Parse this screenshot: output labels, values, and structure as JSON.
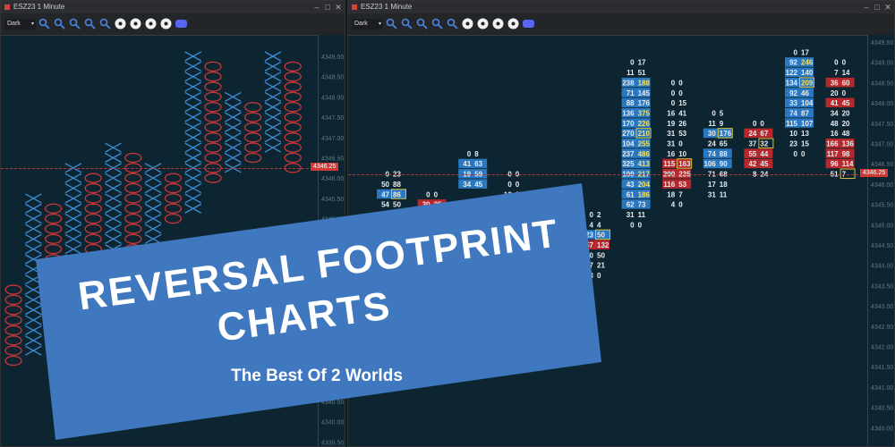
{
  "left_window": {
    "title": "ESZ23 1 Minute",
    "theme_select": "Dark",
    "toolbar_icons": [
      "layout-icon",
      "zoom-in-icon",
      "zoom-out-icon",
      "search-icon",
      "pencil-tool-icon",
      "cursor-icon",
      "line-icon",
      "info-icon",
      "refresh-icon",
      "discord-icon"
    ],
    "price_tag": "4346.25",
    "axis_labels": [
      "4349.00",
      "4348.50",
      "4348.00",
      "4347.50",
      "4347.00",
      "4346.50",
      "4346.00",
      "4345.50",
      "4345.00",
      "4344.50",
      "4344.00",
      "4343.50",
      "4343.00",
      "4342.50",
      "4342.00",
      "4341.50",
      "4341.00",
      "4340.50",
      "4340.00",
      "4339.50"
    ]
  },
  "right_window": {
    "title": "ESZ23 1 Minute",
    "theme_select": "Dark",
    "toolbar_icons": [
      "layout-icon",
      "zoom-in-icon",
      "zoom-out-icon",
      "search-icon",
      "pencil-tool-icon",
      "cursor-icon",
      "line-icon",
      "info-icon",
      "refresh-icon",
      "discord-icon"
    ],
    "price_tag": "4346.25",
    "axis_labels": [
      "4349.50",
      "4349.00",
      "4348.50",
      "4348.00",
      "4347.50",
      "4347.00",
      "4346.50",
      "4346.00",
      "4345.50",
      "4345.00",
      "4344.50",
      "4344.00",
      "4343.50",
      "4343.00",
      "4342.50",
      "4342.00",
      "4341.50",
      "4341.00",
      "4340.50",
      "4340.00",
      "4339.50"
    ]
  },
  "banner": {
    "title_line1": "REVERSAL FOOTPRINT",
    "title_line2": "CHARTS",
    "subtitle": "The Best Of 2 Worlds",
    "color": "#3f78bf"
  },
  "chart_data": [
    {
      "type": "point_and_figure",
      "price_step": 0.25,
      "ylim": [
        4339.5,
        4349.25
      ],
      "columns": [
        {
          "kind": "O",
          "high": 4343.25,
          "low": 4341.5
        },
        {
          "kind": "X",
          "high": 4345.5,
          "low": 4341.75
        },
        {
          "kind": "O",
          "high": 4345.25,
          "low": 4342.5
        },
        {
          "kind": "X",
          "high": 4346.25,
          "low": 4342.75
        },
        {
          "kind": "O",
          "high": 4346.0,
          "low": 4343.25
        },
        {
          "kind": "X",
          "high": 4346.75,
          "low": 4343.5
        },
        {
          "kind": "O",
          "high": 4346.5,
          "low": 4344.0
        },
        {
          "kind": "X",
          "high": 4346.25,
          "low": 4344.25
        },
        {
          "kind": "O",
          "high": 4346.0,
          "low": 4345.0
        },
        {
          "kind": "X",
          "high": 4349.0,
          "low": 4345.25
        },
        {
          "kind": "O",
          "high": 4348.75,
          "low": 4346.0
        },
        {
          "kind": "X",
          "high": 4348.0,
          "low": 4346.25
        },
        {
          "kind": "O",
          "high": 4347.75,
          "low": 4346.5
        },
        {
          "kind": "X",
          "high": 4349.0,
          "low": 4346.75
        },
        {
          "kind": "O",
          "high": 4348.75,
          "low": 4346.25
        }
      ],
      "colors": {
        "X": "#3c8dd6",
        "O": "#c8363a"
      }
    },
    {
      "type": "footprint",
      "ylim": [
        4339.5,
        4349.5
      ],
      "columns": [
        {
          "top": 4346.25,
          "cells": [
            [
              "0",
              "23"
            ],
            [
              "50",
              "88"
            ],
            [
              "47",
              "86"
            ],
            [
              "54",
              "50"
            ]
          ],
          "colors": [
            "n",
            "n",
            "b",
            "n"
          ],
          "box": 2
        },
        {
          "top": 4345.75,
          "cells": [
            [
              "0",
              "0"
            ],
            [
              "30",
              "25"
            ],
            [
              "33",
              "17"
            ]
          ],
          "colors": [
            "n",
            "r",
            "n"
          ]
        },
        {
          "top": 4346.75,
          "cells": [
            [
              "0",
              "8"
            ],
            [
              "41",
              "63"
            ],
            [
              "19",
              "59"
            ],
            [
              "34",
              "45"
            ]
          ],
          "colors": [
            "n",
            "b",
            "b",
            "b"
          ]
        },
        {
          "top": 4346.25,
          "cells": [
            [
              "0",
              "0"
            ],
            [
              "0",
              "0"
            ],
            [
              "13",
              "17"
            ]
          ],
          "colors": [
            "n",
            "n",
            "n"
          ]
        },
        {
          "top": 4345.75,
          "cells": [
            [
              "0",
              "50"
            ]
          ],
          "colors": [
            "n"
          ]
        },
        {
          "top": 4345.25,
          "cells": [
            [
              "0",
              "2"
            ],
            [
              "4",
              "4"
            ],
            [
              "23",
              "50"
            ],
            [
              "57",
              "132"
            ],
            [
              "50",
              "50"
            ],
            [
              "27",
              "21"
            ],
            [
              "3",
              "0"
            ]
          ],
          "colors": [
            "n",
            "n",
            "b",
            "r",
            "n",
            "n",
            "n"
          ],
          "box": 2
        },
        {
          "top": 4349.0,
          "cells": [
            [
              "0",
              "17"
            ],
            [
              "11",
              "51"
            ],
            [
              "238",
              "188"
            ],
            [
              "71",
              "145"
            ],
            [
              "88",
              "176"
            ],
            [
              "136",
              "375"
            ],
            [
              "170",
              "226"
            ],
            [
              "270",
              "210"
            ],
            [
              "104",
              "255"
            ],
            [
              "237",
              "486"
            ],
            [
              "325",
              "413"
            ],
            [
              "109",
              "217"
            ],
            [
              "43",
              "204"
            ],
            [
              "61",
              "186"
            ],
            [
              "62",
              "73"
            ],
            [
              "31",
              "11"
            ],
            [
              "0",
              "0"
            ]
          ],
          "colors": [
            "n",
            "n",
            "b",
            "b",
            "b",
            "b",
            "b",
            "b",
            "b",
            "b",
            "b",
            "b",
            "b",
            "b",
            "b",
            "n",
            "n"
          ],
          "box": 7
        },
        {
          "top": 4348.5,
          "cells": [
            [
              "0",
              "0"
            ],
            [
              "0",
              "0"
            ],
            [
              "0",
              "15"
            ],
            [
              "16",
              "41"
            ],
            [
              "19",
              "26"
            ],
            [
              "31",
              "53"
            ],
            [
              "31",
              "0"
            ],
            [
              "16",
              "10"
            ],
            [
              "115",
              "163"
            ],
            [
              "200",
              "235"
            ],
            [
              "116",
              "53"
            ],
            [
              "18",
              "7"
            ],
            [
              "4",
              "0"
            ]
          ],
          "colors": [
            "n",
            "n",
            "n",
            "n",
            "n",
            "n",
            "n",
            "n",
            "r",
            "r",
            "r",
            "n",
            "n"
          ],
          "box": 8
        },
        {
          "top": 4347.75,
          "cells": [
            [
              "0",
              "5"
            ],
            [
              "11",
              "9"
            ],
            [
              "30",
              "176"
            ],
            [
              "24",
              "65"
            ],
            [
              "74",
              "88"
            ],
            [
              "106",
              "90"
            ],
            [
              "71",
              "68"
            ],
            [
              "17",
              "18"
            ],
            [
              "31",
              "11"
            ]
          ],
          "colors": [
            "n",
            "n",
            "b",
            "n",
            "b",
            "b",
            "n",
            "n",
            "n"
          ],
          "box": 2
        },
        {
          "top": 4347.5,
          "cells": [
            [
              "0",
              "0"
            ],
            [
              "24",
              "67"
            ],
            [
              "37",
              "32"
            ],
            [
              "55",
              "44"
            ],
            [
              "42",
              "45"
            ],
            [
              "8",
              "24"
            ]
          ],
          "colors": [
            "n",
            "r",
            "n",
            "r",
            "r",
            "n"
          ],
          "box": 2
        },
        {
          "top": 4349.25,
          "cells": [
            [
              "0",
              "17"
            ],
            [
              "92",
              "246"
            ],
            [
              "122",
              "140"
            ],
            [
              "134",
              "209"
            ],
            [
              "92",
              "46"
            ],
            [
              "33",
              "104"
            ],
            [
              "74",
              "87"
            ],
            [
              "115",
              "107"
            ],
            [
              "10",
              "13"
            ],
            [
              "23",
              "15"
            ],
            [
              "0",
              "0"
            ]
          ],
          "colors": [
            "n",
            "b",
            "b",
            "b",
            "b",
            "b",
            "b",
            "b",
            "n",
            "n",
            "n"
          ],
          "box": 3
        },
        {
          "top": 4349.0,
          "cells": [
            [
              "0",
              "0"
            ],
            [
              "7",
              "14"
            ],
            [
              "36",
              "60"
            ],
            [
              "20",
              "0"
            ],
            [
              "41",
              "45"
            ],
            [
              "34",
              "20"
            ],
            [
              "48",
              "20"
            ],
            [
              "16",
              "48"
            ],
            [
              "166",
              "136"
            ],
            [
              "117",
              "98"
            ],
            [
              "96",
              "114"
            ],
            [
              "51",
              "7"
            ]
          ],
          "colors": [
            "n",
            "n",
            "r",
            "n",
            "r",
            "n",
            "n",
            "n",
            "r",
            "r",
            "r",
            "n"
          ],
          "box": 11
        }
      ]
    }
  ]
}
